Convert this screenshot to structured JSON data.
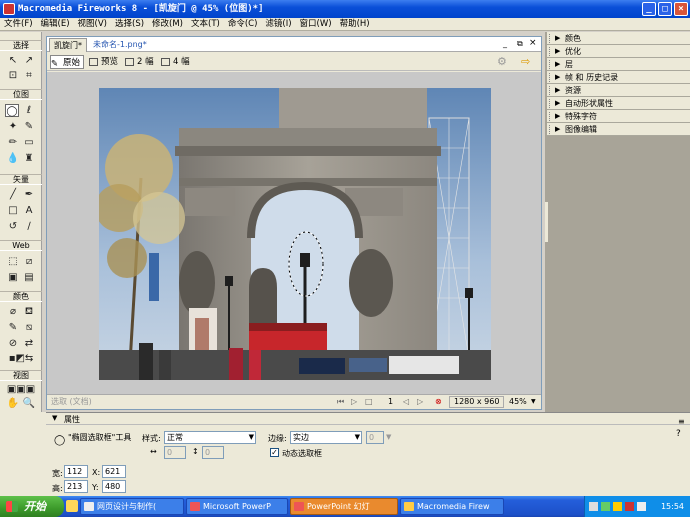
{
  "window": {
    "title": "Macromedia Fireworks 8 - [凯旋门 @  45% (位图)*]",
    "min": "_",
    "max": "□",
    "close": "×"
  },
  "menu": [
    "文件(F)",
    "编辑(E)",
    "视图(V)",
    "选择(S)",
    "修改(M)",
    "文本(T)",
    "命令(C)",
    "滤镜(I)",
    "窗口(W)",
    "帮助(H)"
  ],
  "toolbox": {
    "sections": [
      "选择",
      "位图",
      "矢量",
      "Web",
      "颜色",
      "视图"
    ]
  },
  "document": {
    "tabs": [
      "凯旋门*",
      "未命名-1.png*"
    ],
    "views": [
      "原始",
      "预览",
      "2 幅",
      "4 幅"
    ],
    "status": {
      "frame": "1",
      "size": "1280 x 960",
      "zoom": "45%",
      "hint": "选取 (文档)"
    }
  },
  "panels": [
    "颜色",
    "优化",
    "层",
    "帧 和 历史记录",
    "资源",
    "自动形状属性",
    "特殊字符",
    "图像编辑"
  ],
  "properties": {
    "header": "属性",
    "tool_name": "\"椭圆选取框\"工具",
    "style_label": "样式:",
    "style_value": "正常",
    "edge_label": "边缘:",
    "edge_value": "实边",
    "edge_num": "0",
    "dynamic_marquee": "动态选取框",
    "dynamic_checked": true,
    "w_label": "宽:",
    "w_value": "112",
    "h_label": "高:",
    "h_value": "213",
    "x_label": "X:",
    "x_value": "621",
    "y_label": "Y:",
    "y_value": "480",
    "w_fixed": "0",
    "h_fixed": "0"
  },
  "taskbar": {
    "start": "开始",
    "tasks": [
      "网页设计与制作(",
      "Microsoft PowerP",
      "PowerPoint 幻灯",
      "Macromedia Firew"
    ],
    "active_index": 2,
    "clock": "15:54"
  }
}
